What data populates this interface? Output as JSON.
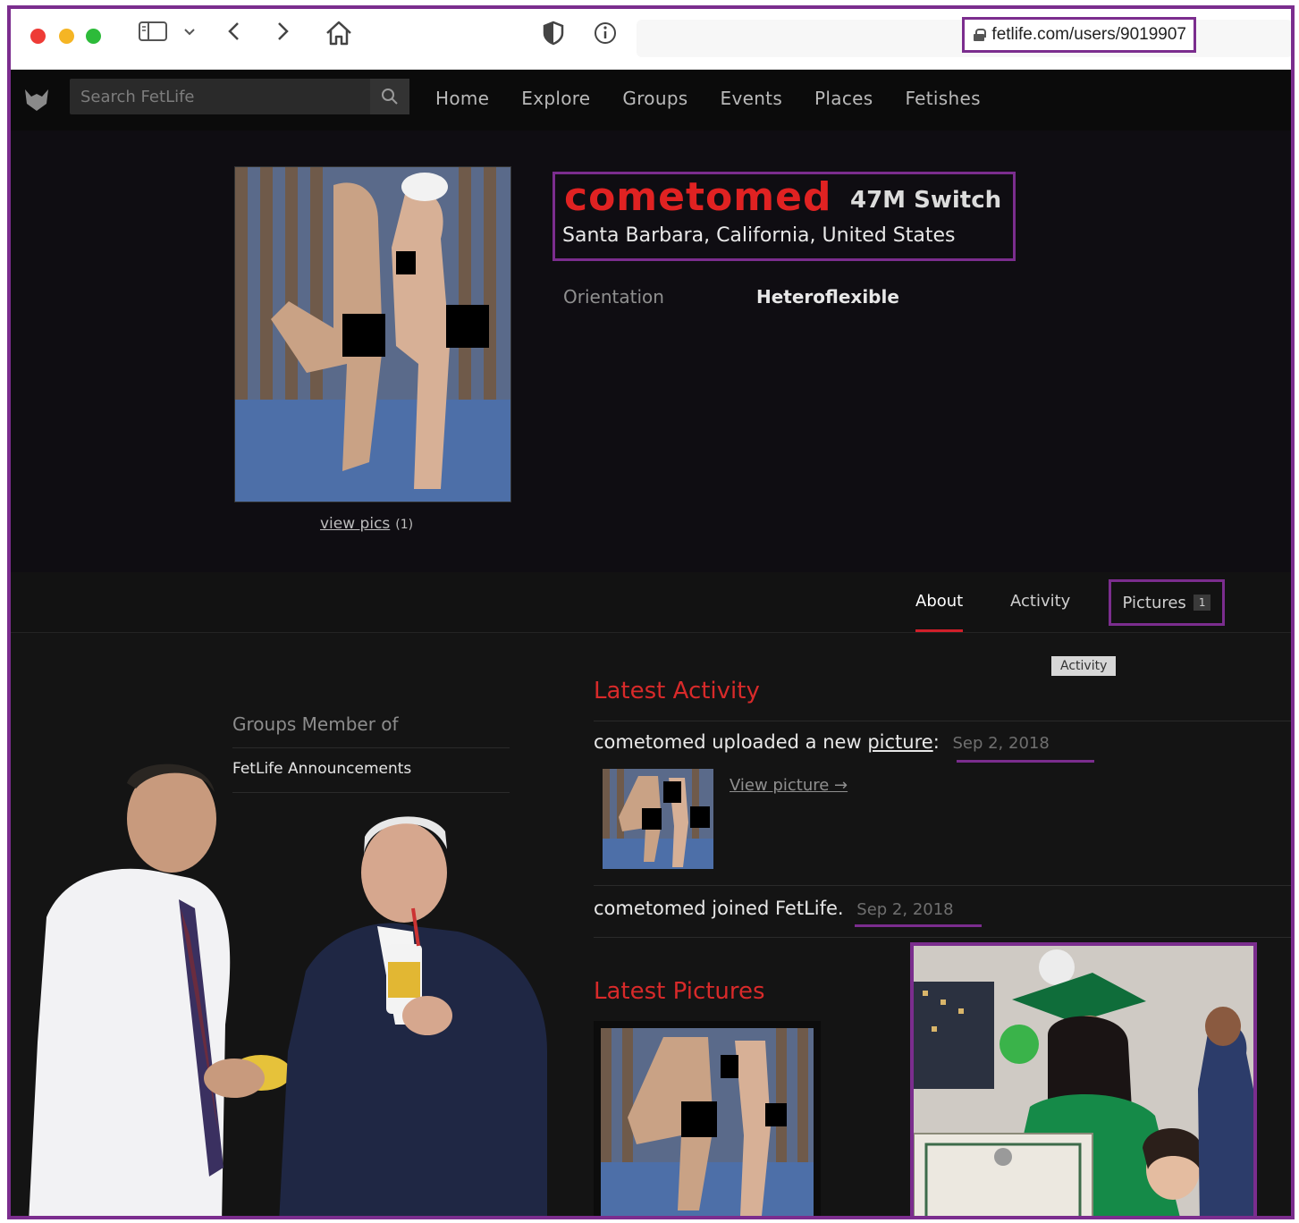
{
  "browser": {
    "url": "fetlife.com/users/9019907",
    "icons": [
      "sidebar-icon",
      "chevron-down-icon",
      "back-icon",
      "forward-icon",
      "home-icon",
      "shield-icon",
      "info-icon",
      "lock-icon"
    ]
  },
  "nav": {
    "search_placeholder": "Search FetLife",
    "links": [
      "Home",
      "Explore",
      "Groups",
      "Events",
      "Places",
      "Fetishes"
    ]
  },
  "profile": {
    "nickname": "cometomed",
    "meta": "47M Switch",
    "location": "Santa Barbara, California, United States",
    "view_pics_label": "view pics",
    "view_pics_count": "(1)",
    "orientation_label": "Orientation",
    "orientation_value": "Heteroflexible"
  },
  "tabs": {
    "about": "About",
    "activity": "Activity",
    "pictures": "Pictures",
    "pictures_count": "1",
    "tooltip": "Activity"
  },
  "groups": {
    "title": "Groups Member of",
    "items": [
      "FetLife Announcements"
    ]
  },
  "activity": {
    "title": "Latest Activity",
    "item1_prefix": "cometomed uploaded a new",
    "item1_link": "picture",
    "item1_sep": ":",
    "item1_date": "Sep 2, 2018",
    "view_picture": "View picture →",
    "item2_text": "cometomed joined FetLife.",
    "item2_date": "Sep 2, 2018"
  },
  "pictures": {
    "title": "Latest Pictures"
  },
  "colors": {
    "accent_red": "#e02222",
    "annotation_purple": "#7b2d8e",
    "nav_bg": "#0b0b0b",
    "page_bg": "#141414"
  }
}
